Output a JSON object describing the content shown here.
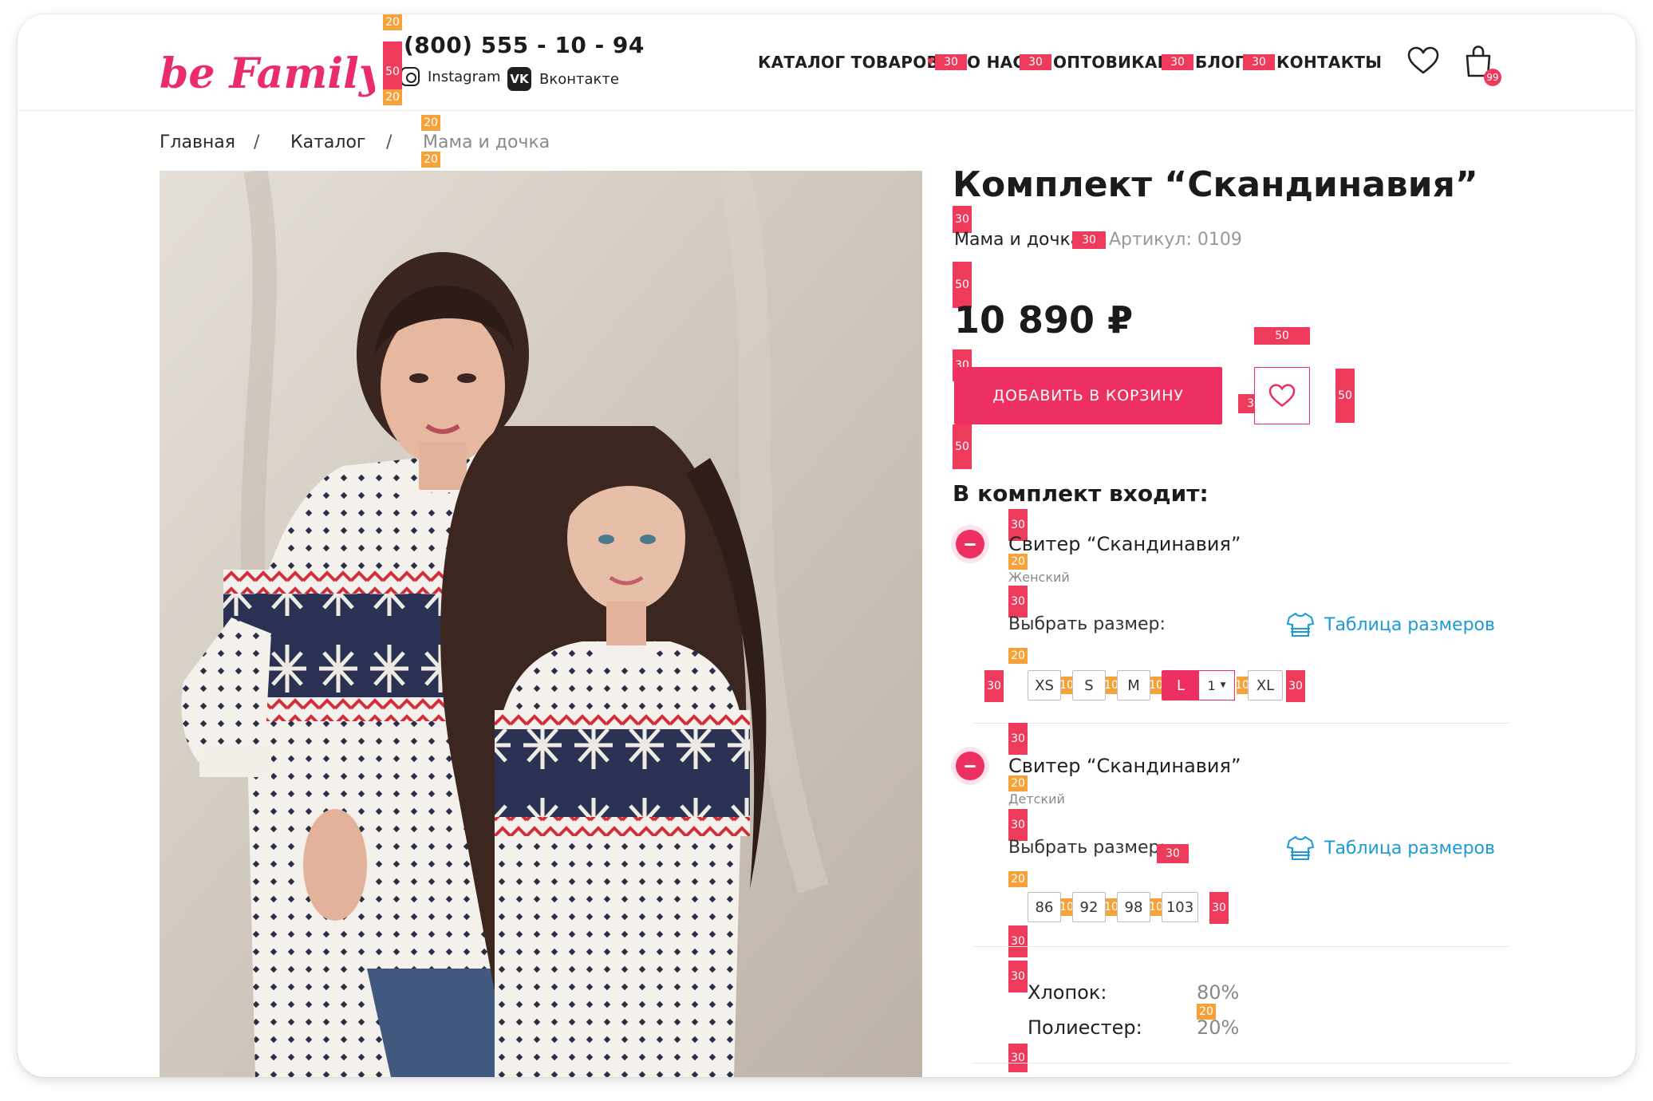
{
  "header": {
    "brand": "be Family",
    "phone": "(800) 555 - 10 - 94",
    "social": {
      "instagram": "Instagram",
      "vk": "Вконтакте",
      "vk_glyph": "VK"
    },
    "nav": [
      "КАТАЛОГ ТОВАРОВ",
      "О НАС",
      "ОПТОВИКАМ",
      "БЛОГ",
      "КОНТАКТЫ"
    ],
    "cart_count": "99",
    "icons": [
      "heart-icon",
      "cart-icon",
      "chevron-down-icon"
    ]
  },
  "breadcrumb": [
    "Главная",
    "Каталог",
    "Мама и дочка"
  ],
  "breadcrumb_sep": "/",
  "product": {
    "title": "Комплект “Скандинавия”",
    "category": "Мама и дочка",
    "sku": "Артикул: 0109",
    "price": "10 890 ₽",
    "add_to_cart": "ДОБАВИТЬ В КОРЗИНУ",
    "kit_title": "В комплект входит:",
    "items": [
      {
        "name": "Свитер “Скандинавия”",
        "subtitle": "Женский",
        "size_label": "Выбрать размер:",
        "size_table": "Таблица размеров",
        "sizes": [
          "XS",
          "S",
          "M",
          "L",
          "XL"
        ],
        "selected_size": "L",
        "quantity": "1"
      },
      {
        "name": "Свитер “Скандинавия”",
        "subtitle": "Детский",
        "size_label": "Выбрать размер:",
        "size_table": "Таблица размеров",
        "sizes": [
          "86",
          "92",
          "98",
          "103"
        ]
      }
    ],
    "composition": [
      {
        "label": "Хлопок:",
        "value": "80%"
      },
      {
        "label": "Полиестер:",
        "value": "20%"
      }
    ]
  },
  "markers": [
    "20",
    "50",
    "30",
    "10"
  ],
  "colors": {
    "accent": "#ee2f62",
    "marker_red": "#ee3b5c",
    "marker_orange": "#f5a23a",
    "link": "#1b9ad6"
  }
}
